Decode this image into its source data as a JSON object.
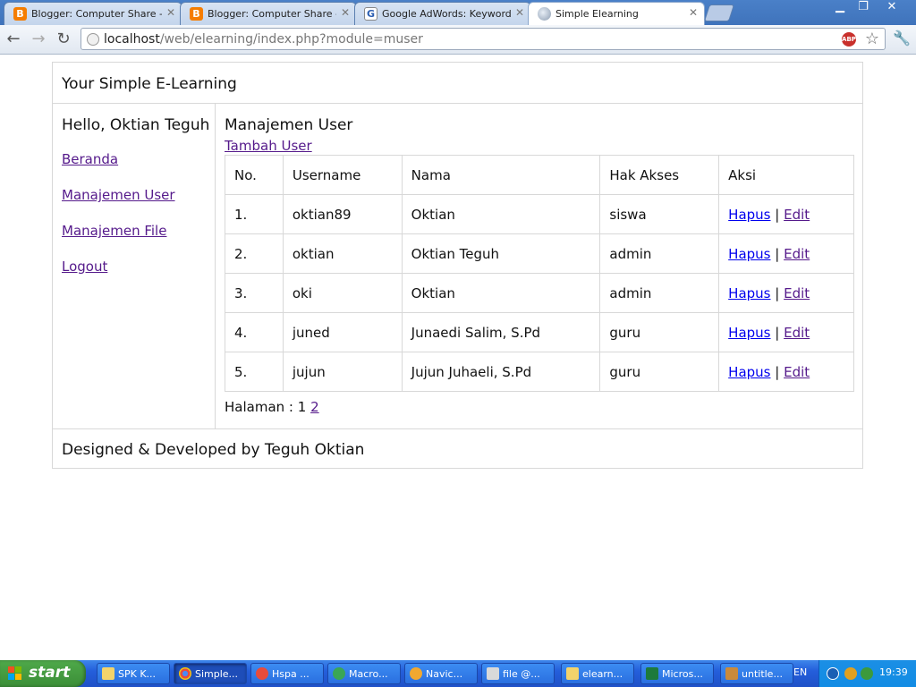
{
  "browser": {
    "tabs": [
      {
        "title": "Blogger: Computer Share - All",
        "favicon": "blogger-icon"
      },
      {
        "title": "Blogger: Computer Share - Cre",
        "favicon": "blogger-icon"
      },
      {
        "title": "Google AdWords: Keyword To",
        "favicon": "google-icon"
      },
      {
        "title": "Simple Elearning",
        "favicon": "globe-icon",
        "active": true
      }
    ],
    "url_host": "localhost",
    "url_path": "/web/elearning/index.php?module=muser",
    "abp_label": "ABP"
  },
  "site": {
    "title": "Your Simple E-Learning",
    "footer": "Designed & Developed by Teguh Oktian"
  },
  "sidebar": {
    "greeting": "Hello, Oktian Teguh",
    "items": [
      {
        "label": "Beranda"
      },
      {
        "label": "Manajemen User"
      },
      {
        "label": "Manajemen File"
      },
      {
        "label": "Logout"
      }
    ]
  },
  "main": {
    "title": "Manajemen User",
    "add_link": "Tambah User",
    "table": {
      "headers": [
        "No.",
        "Username",
        "Nama",
        "Hak Akses",
        "Aksi"
      ],
      "rows": [
        {
          "no": "1.",
          "username": "oktian89",
          "nama": "Oktian",
          "hak_akses": "siswa"
        },
        {
          "no": "2.",
          "username": "oktian",
          "nama": "Oktian Teguh",
          "hak_akses": "admin"
        },
        {
          "no": "3.",
          "username": "oki",
          "nama": "Oktian",
          "hak_akses": "admin"
        },
        {
          "no": "4.",
          "username": "juned",
          "nama": "Junaedi Salim, S.Pd",
          "hak_akses": "guru"
        },
        {
          "no": "5.",
          "username": "jujun",
          "nama": "Jujun Juhaeli, S.Pd",
          "hak_akses": "guru"
        }
      ],
      "action_delete": "Hapus",
      "action_separator": "|",
      "action_edit": "Edit"
    },
    "pagination": {
      "label": "Halaman :",
      "current": "1",
      "next": "2"
    }
  },
  "taskbar": {
    "start_label": "start",
    "tasks": [
      {
        "label": "SPK K...",
        "icon": "folder-icon"
      },
      {
        "label": "Simple...",
        "icon": "chrome-icon",
        "active": true
      },
      {
        "label": "Hspa ...",
        "icon": "hspa-icon"
      },
      {
        "label": "Macro...",
        "icon": "macromedia-icon"
      },
      {
        "label": "Navic...",
        "icon": "navicat-icon"
      },
      {
        "label": "file @...",
        "icon": "file-icon"
      },
      {
        "label": "elearn...",
        "icon": "folder-icon"
      },
      {
        "label": "Micros...",
        "icon": "excel-icon"
      },
      {
        "label": "untitle...",
        "icon": "paint-icon"
      }
    ],
    "language": "EN",
    "clock": "19:39"
  },
  "colors": {
    "link_visited": "#551a8b",
    "link_unvisited": "#0000ee",
    "taskbar_blue": "#245edb",
    "start_green": "#3b8e37"
  }
}
